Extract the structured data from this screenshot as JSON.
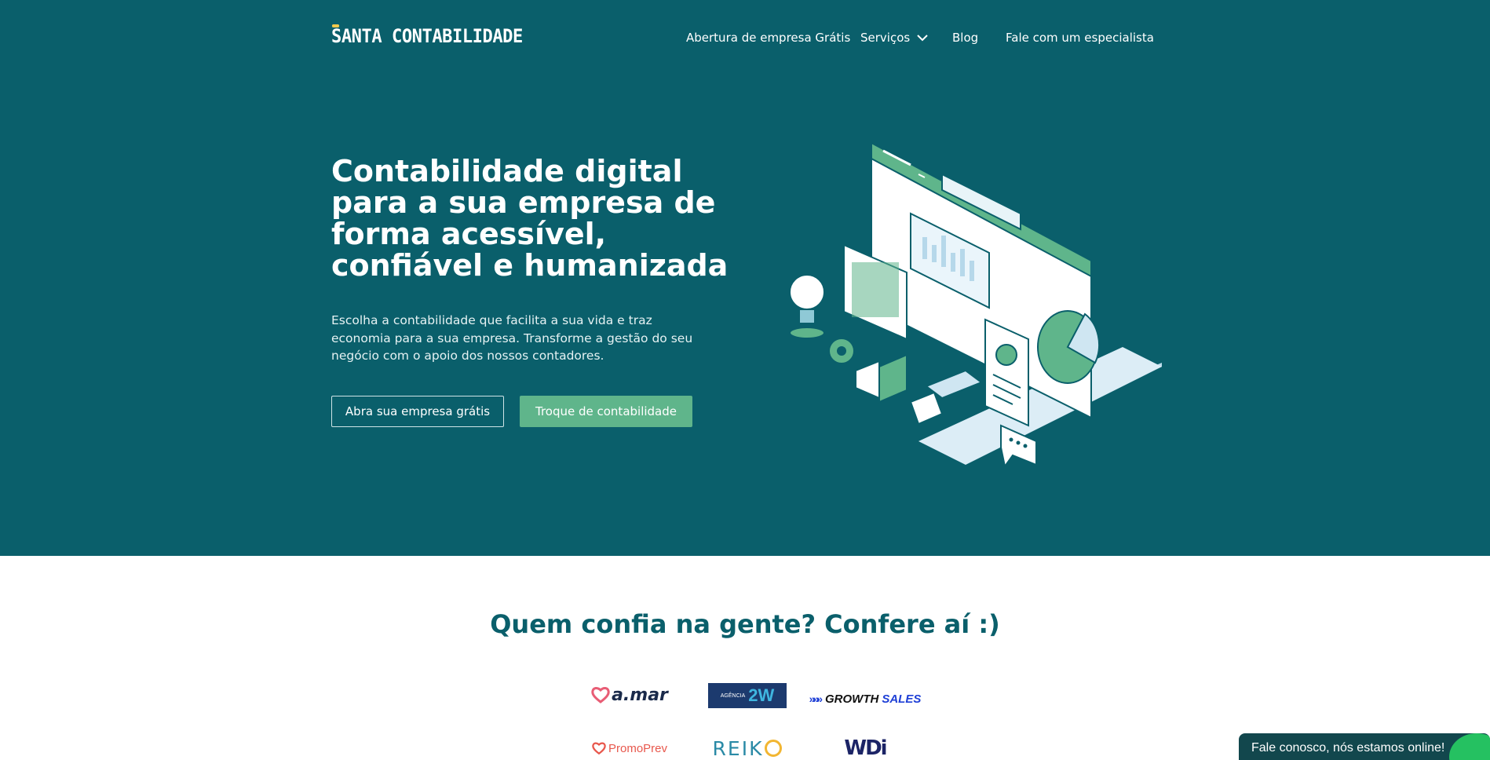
{
  "brand": {
    "name": "SANTA CONTABILIDADE",
    "halo_color": "#f2c94c"
  },
  "colors": {
    "primary": "#0a5f6b",
    "accent": "#5fb58b",
    "chat_bg": "#12474d",
    "whatsapp": "#25c161"
  },
  "nav": {
    "items": [
      {
        "label": "Abertura de empresa Grátis"
      },
      {
        "label": "Serviços",
        "icon": "chevron-down-icon"
      },
      {
        "label": "Blog"
      },
      {
        "label": "Fale com um especialista"
      }
    ]
  },
  "hero": {
    "headline": {
      "l1": "Contabilidade digital",
      "l2": "para a sua empresa de",
      "l3a": "forma ",
      "l3b": "acessível",
      "l3c": ",",
      "l4a": "confiável",
      "l4b": " e ",
      "l4c": "humanizada"
    },
    "subtitle": "Escolha a contabilidade que facilita a sua vida e traz economia para a sua empresa. Transforme a gestão do seu negócio com o apoio dos nossos contadores.",
    "buttons": {
      "primary": "Abra sua empresa grátis",
      "secondary": "Troque de contabilidade"
    }
  },
  "trust": {
    "h_a": "Quem ",
    "h_b": "confia",
    "h_c": " na gente? Confere aí :)",
    "logos": {
      "amar": "a.mar",
      "agencia_small": "AGÊNCIA",
      "agencia_big": "2W",
      "growth_a": "GROWTH",
      "growth_b": "SALES",
      "promoprev": "PromoPrev",
      "reiko_a": "REIK",
      "wdi": "WDi"
    }
  },
  "chat": {
    "label": "Fale conosco, nós estamos online!"
  }
}
